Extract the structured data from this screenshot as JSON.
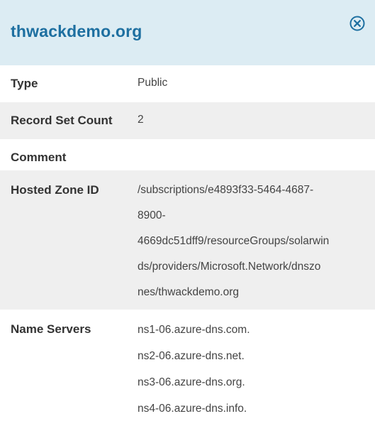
{
  "panel": {
    "title": "thwackdemo.org",
    "close_icon": "close-circle-icon"
  },
  "fields": {
    "type": {
      "label": "Type",
      "value": "Public"
    },
    "record_set_count": {
      "label": "Record Set Count",
      "value": "2"
    },
    "comment": {
      "label": "Comment",
      "value": ""
    },
    "hosted_zone_id": {
      "label": "Hosted Zone ID",
      "lines": [
        "/subscriptions/e4893f33-5464-4687-",
        "8900-",
        "4669dc51dff9/resourceGroups/solarwin",
        "ds/providers/Microsoft.Network/dnszo",
        "nes/thwackdemo.org"
      ]
    },
    "name_servers": {
      "label": "Name Servers",
      "values": [
        "ns1-06.azure-dns.com.",
        "ns2-06.azure-dns.net.",
        "ns3-06.azure-dns.org.",
        "ns4-06.azure-dns.info."
      ]
    }
  },
  "colors": {
    "header_bg": "#dcecf3",
    "title": "#1d6fa0",
    "shaded_row": "#efefef"
  }
}
